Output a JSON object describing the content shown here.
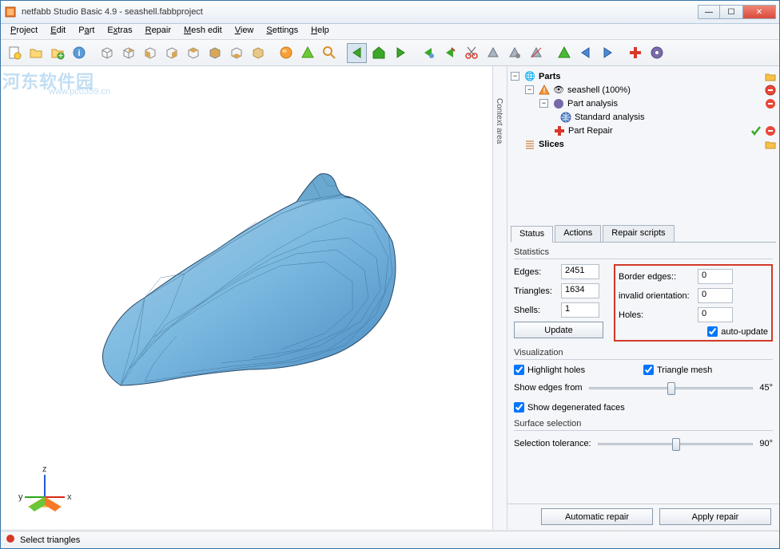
{
  "window": {
    "title": "netfabb Studio Basic 4.9 - seashell.fabbproject"
  },
  "menu": [
    "Project",
    "Edit",
    "Part",
    "Extras",
    "Repair",
    "Mesh edit",
    "View",
    "Settings",
    "Help"
  ],
  "context_label": "Context area",
  "tree": {
    "root": "Parts",
    "part": "seashell (100%)",
    "analysis": "Part analysis",
    "std": "Standard analysis",
    "repair": "Part Repair",
    "slices": "Slices"
  },
  "tabs": {
    "status": "Status",
    "actions": "Actions",
    "scripts": "Repair scripts"
  },
  "stats": {
    "heading": "Statistics",
    "edges_l": "Edges:",
    "edges_v": "2451",
    "tri_l": "Triangles:",
    "tri_v": "1634",
    "shells_l": "Shells:",
    "shells_v": "1",
    "border_l": "Border edges::",
    "border_v": "0",
    "inv_l": "invalid orientation:",
    "inv_v": "0",
    "holes_l": "Holes:",
    "holes_v": "0",
    "update": "Update",
    "auto": "auto-update"
  },
  "viz": {
    "heading": "Visualization",
    "hh": "Highlight holes",
    "tm": "Triangle mesh",
    "sef": "Show edges from",
    "deg": "45°",
    "sdf": "Show degenerated faces"
  },
  "surf": {
    "heading": "Surface selection",
    "tol": "Selection tolerance:",
    "deg": "90°"
  },
  "actions": {
    "auto": "Automatic repair",
    "apply": "Apply repair"
  },
  "status": "Select triangles",
  "wm1": "河东软件园",
  "wm2": "www.pc0359.cn"
}
